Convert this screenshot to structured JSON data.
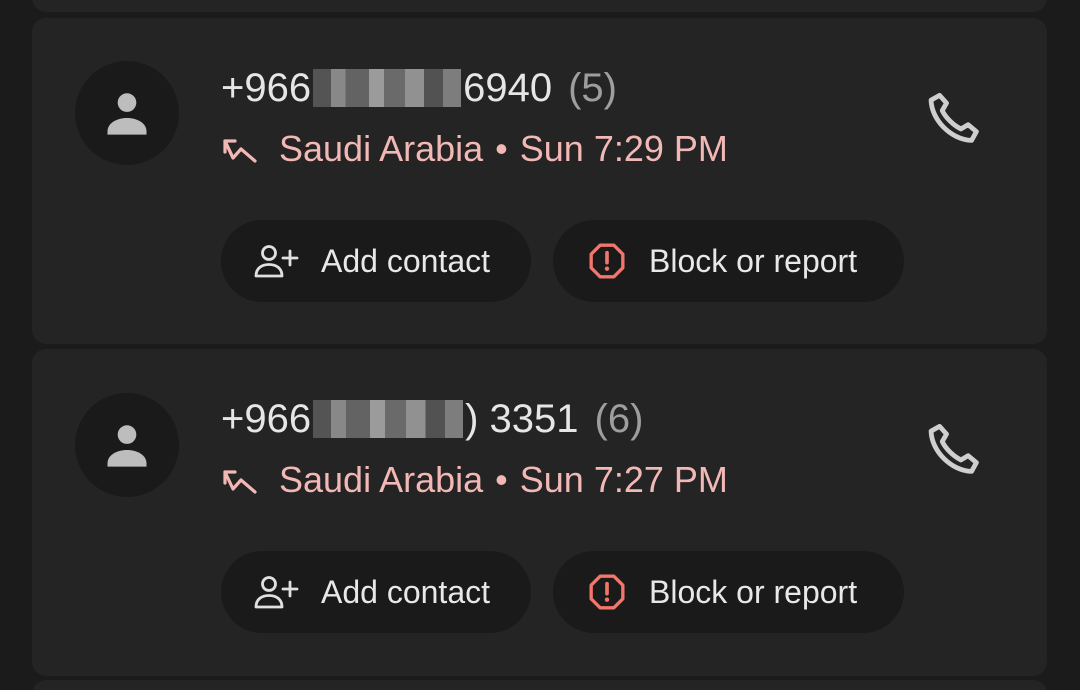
{
  "calls": [
    {
      "number_prefix": "+966",
      "number_suffix": "6940",
      "count": "(5)",
      "country": "Saudi Arabia",
      "separator": "•",
      "time": "Sun 7:29 PM",
      "add_contact_label": "Add contact",
      "block_label": "Block or report"
    },
    {
      "number_prefix": "+966",
      "number_suffix": ") 3351",
      "count": "(6)",
      "country": "Saudi Arabia",
      "separator": "•",
      "time": "Sun 7:27 PM",
      "add_contact_label": "Add contact",
      "block_label": "Block or report"
    }
  ],
  "icons": {
    "avatar": "person-icon",
    "missed_call": "missed-call-icon",
    "call": "phone-icon",
    "add_contact": "person-add-icon",
    "block": "report-icon"
  },
  "colors": {
    "background": "#1b1b1b",
    "card": "#242424",
    "missed_call_text": "#f2b8b5",
    "report_icon": "#f2766b"
  }
}
